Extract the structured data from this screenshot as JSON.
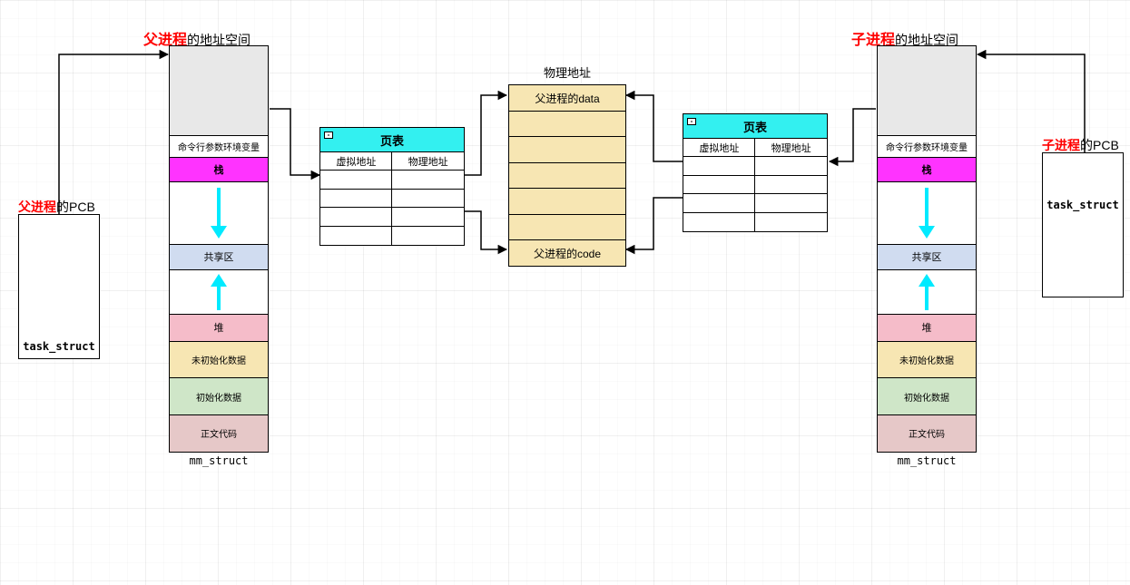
{
  "parent": {
    "title_prefix": "父进程",
    "title_suffix": "的地址空间",
    "pcb_title_prefix": "父进程",
    "pcb_title_suffix": "的PCB",
    "pcb_struct": "task_struct",
    "mm_label": "mm_struct",
    "segments": {
      "env": "命令行参数环境变量",
      "stack": "栈",
      "shared": "共享区",
      "heap": "堆",
      "bss": "未初始化数据",
      "data": "初始化数据",
      "text": "正文代码"
    }
  },
  "child": {
    "title_prefix": "子进程",
    "title_suffix": "的地址空间",
    "pcb_title_prefix": "子进程",
    "pcb_title_suffix": "的PCB",
    "pcb_struct": "task_struct",
    "mm_label": "mm_struct",
    "segments": {
      "env": "命令行参数环境变量",
      "stack": "栈",
      "shared": "共享区",
      "heap": "堆",
      "bss": "未初始化数据",
      "data": "初始化数据",
      "text": "正文代码"
    }
  },
  "pagetable": {
    "title": "页表",
    "col_virtual": "虚拟地址",
    "col_physical": "物理地址"
  },
  "physical": {
    "title": "物理地址",
    "rows": [
      "父进程的data",
      "",
      "",
      "",
      "",
      "",
      "父进程的code"
    ]
  }
}
